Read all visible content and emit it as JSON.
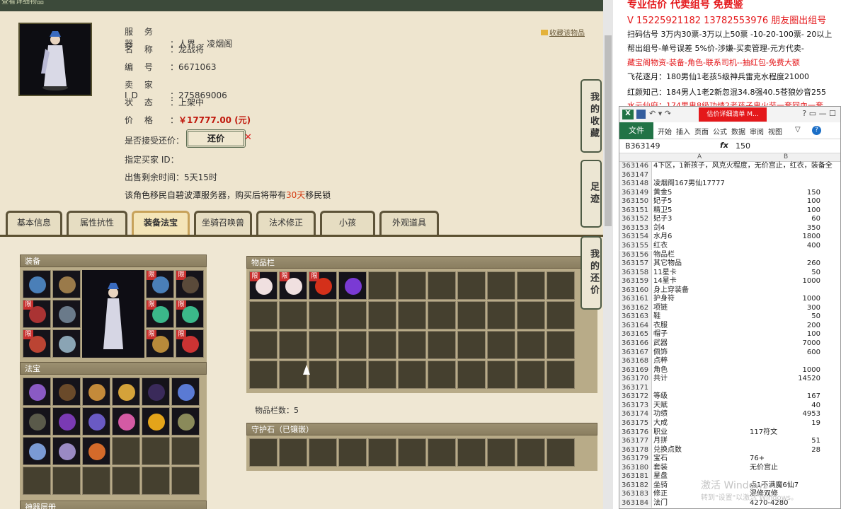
{
  "window": {
    "title": "查看详细物品"
  },
  "info": {
    "rows": [
      {
        "key": "服 务 器",
        "value": "人界 -- 凌烟阁"
      },
      {
        "key": "名 称",
        "value": "龙战将"
      },
      {
        "key": "编 号",
        "value": "6671063"
      },
      {
        "key": "卖 家 ID",
        "value": "275869006"
      },
      {
        "key": "状 态",
        "value": "上架中"
      },
      {
        "key": "价 格",
        "value": "￥17777.00 (元)"
      }
    ],
    "offer_label": "是否接受还价：",
    "offer_button": "还价",
    "buyer_label": "指定买家 ID：",
    "remain_label": "出售剩余时间：",
    "remain_value": "5天15时",
    "note_prefix": "该角色移民自碧波潭服务器，购买后将带有",
    "note_days": "30天",
    "note_suffix": "移民锁",
    "fav_label": "收藏该物品"
  },
  "tabs": [
    "基本信息",
    "属性抗性",
    "装备法宝",
    "坐骑召唤兽",
    "法术修正",
    "小孩",
    "外观道具"
  ],
  "active_tab": "装备法宝",
  "panels": {
    "equip": "装备",
    "treasure": "法宝",
    "items": "物品栏",
    "items_count": "物品栏数：5",
    "guard": "守护石（已镶嵌）",
    "bottom": "神器层册"
  },
  "side_buttons": [
    "我的收藏",
    "足迹",
    "我的还价"
  ],
  "ads": {
    "line0": "专业估价 代卖组号 免费鉴",
    "line1": "V 15225921182   13782553976 朋友圈出组号",
    "line2": "扫码估号 3万内30票-3万以上50票 -10-20-100票- 20以上",
    "line3": "帮出组号-单号误差 5%价-涉嫌-买卖管理-元方代卖-",
    "line4": "藏宝阁物资-装备-角色-联系司机--抽红包-免费大额",
    "line5": "飞花逐月：180男仙1老孩5级神兵雷克水程度21000",
    "line6": "红颜知己：184男人1老2新忽混34.8强40.5苍狼妙音255",
    "line7": "水云仙府：174男鬼8级功绩2老孩子鬼火装一套回血一套"
  },
  "excel": {
    "title_button": "估价详细清单 M...",
    "ribbon": [
      "文件",
      "开始",
      "插入",
      "页面",
      "公式",
      "数据",
      "审阅",
      "视图"
    ],
    "name_box": "B363149",
    "formula_value": "150",
    "col_a": "A",
    "col_b": "B",
    "rows": [
      {
        "n": "363146",
        "a": "4下区，1新孩子，风克火程度，无价宫止，红衣，装备全",
        "b": ""
      },
      {
        "n": "363147",
        "a": "",
        "b": ""
      },
      {
        "n": "363148",
        "a": "凌烟阁167男仙17777",
        "b": ""
      },
      {
        "n": "363149",
        "a": "黄金5",
        "b": "150"
      },
      {
        "n": "363150",
        "a": "妃子5",
        "b": "100"
      },
      {
        "n": "363151",
        "a": "精卫5",
        "b": "100"
      },
      {
        "n": "363152",
        "a": "妃子3",
        "b": "60"
      },
      {
        "n": "363153",
        "a": "剑4",
        "b": "350"
      },
      {
        "n": "363154",
        "a": "水月6",
        "b": "1800"
      },
      {
        "n": "363155",
        "a": "红衣",
        "b": "400"
      },
      {
        "n": "363156",
        "a": "物品栏",
        "b": ""
      },
      {
        "n": "363157",
        "a": "其它物品",
        "b": "260"
      },
      {
        "n": "363158",
        "a": "11星卡",
        "b": "50"
      },
      {
        "n": "363159",
        "a": "14星卡",
        "b": "1000"
      },
      {
        "n": "363160",
        "a": "身上穿装备",
        "b": ""
      },
      {
        "n": "363161",
        "a": "护身符",
        "b": "1000"
      },
      {
        "n": "363162",
        "a": "项链",
        "b": "300"
      },
      {
        "n": "363163",
        "a": "鞋",
        "b": "50"
      },
      {
        "n": "363164",
        "a": "衣服",
        "b": "200"
      },
      {
        "n": "363165",
        "a": "帽子",
        "b": "100"
      },
      {
        "n": "363166",
        "a": "武器",
        "b": "7000"
      },
      {
        "n": "363167",
        "a": "佩饰",
        "b": "600"
      },
      {
        "n": "363168",
        "a": "点粹",
        "b": ""
      },
      {
        "n": "363169",
        "a": "角色",
        "b": "1000"
      },
      {
        "n": "363170",
        "a": "共计",
        "b": "14520"
      },
      {
        "n": "363171",
        "a": "",
        "b": ""
      },
      {
        "n": "363172",
        "a": "等级",
        "b": "167"
      },
      {
        "n": "363173",
        "a": "天赋",
        "b": "40"
      },
      {
        "n": "363174",
        "a": "功绩",
        "b": "4953"
      },
      {
        "n": "363175",
        "a": "大成",
        "b": "19"
      },
      {
        "n": "363176",
        "a": "职业",
        "bl": "117符文"
      },
      {
        "n": "363177",
        "a": "月拼",
        "b": "51"
      },
      {
        "n": "363178",
        "a": "兑换点数",
        "b": "28"
      },
      {
        "n": "363179",
        "a": "宝石",
        "bl": "76+"
      },
      {
        "n": "363180",
        "a": "套装",
        "bl": "无价宫止"
      },
      {
        "n": "363181",
        "a": "星盘",
        "b": ""
      },
      {
        "n": "363182",
        "a": "坐骑",
        "bl": "点1不满魔6仙7"
      },
      {
        "n": "363183",
        "a": "修正",
        "bl": "混修双修"
      },
      {
        "n": "363184",
        "a": "法门",
        "bl": "4270-4280"
      }
    ]
  },
  "watermark": {
    "line1": "激活 Windows",
    "line2": "转到\"设置\"以激活 Windows。"
  },
  "colors": {
    "price": "#c0180c",
    "note_days": "#d43b12",
    "excel_green": "#217346",
    "ad_red": "#e4181b"
  }
}
